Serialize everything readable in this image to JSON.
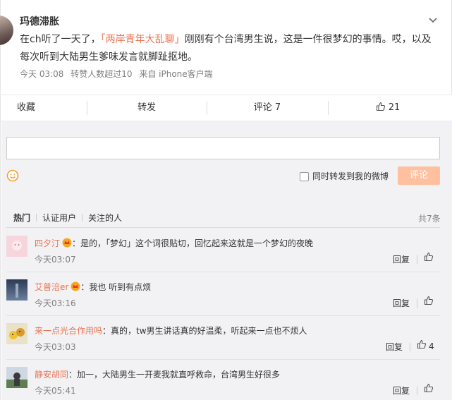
{
  "post": {
    "author": "玛德滞胀",
    "text_before": "在ch听了一天了，",
    "topic": "「两岸青年大乱聊」",
    "text_after": "刚刚有个台湾男生说，这是一件很梦幻的事情。哎，以及每次听到大陆男生爹味发言就脚趾抠地。",
    "time": "今天 03:08",
    "reposts": "转赞人数超过10",
    "source": "来自 iPhone客户端"
  },
  "actions": {
    "collect": "收藏",
    "repost": "转发",
    "comment": "评论 7",
    "like": "21"
  },
  "composer": {
    "forward_label": "同时转发到我的微博",
    "submit": "评论"
  },
  "tabs": {
    "hot": "热门",
    "verified": "认证用户",
    "following": "关注的人",
    "total": "共7条"
  },
  "comments": [
    {
      "user": "四夕汀",
      "text": "：是的，「梦幻」这个词很贴切，回忆起来这就是一个梦幻的夜晚",
      "time": "今天03:07",
      "reply": "回复",
      "likes": ""
    },
    {
      "user": "艾普涪er",
      "text": "：我也 听到有点烦",
      "time": "今天03:16",
      "reply": "回复",
      "likes": ""
    },
    {
      "user": "来一点光合作用吗",
      "text": "：真的，tw男生讲话真的好温柔，听起来一点也不烦人",
      "time": "今天03:03",
      "reply": "回复",
      "likes": "4"
    },
    {
      "user": "静安胡同",
      "text": "：加一，大陆男生一开麦我就直呼救命，台湾男生好很多",
      "time": "今天05:41",
      "reply": "回复",
      "likes": ""
    }
  ],
  "colors": {
    "accent": "#eb7350",
    "submit_disabled": "#ffc09f",
    "background": "#f2f2f5"
  }
}
